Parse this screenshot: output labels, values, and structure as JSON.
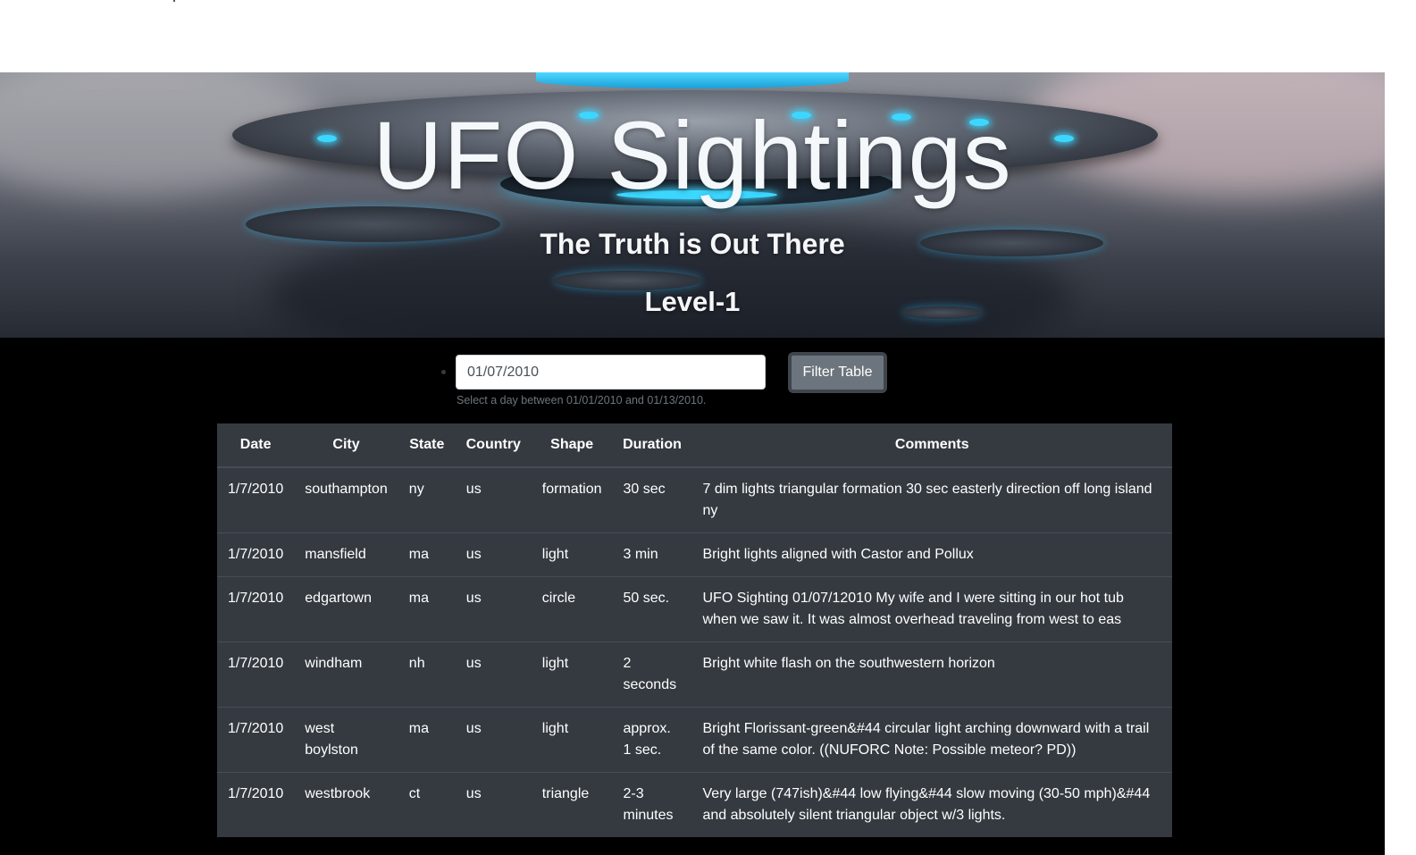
{
  "hero": {
    "title": "UFO Sightings",
    "subtitle": "The Truth is Out There",
    "level": "Level-1"
  },
  "filter": {
    "date_value": "01/07/2010",
    "help_text": "Select a day between 01/01/2010 and 01/13/2010.",
    "button_label": "Filter Table"
  },
  "table": {
    "headers": [
      "Date",
      "City",
      "State",
      "Country",
      "Shape",
      "Duration",
      "Comments"
    ],
    "rows": [
      [
        "1/7/2010",
        "southampton",
        "ny",
        "us",
        "formation",
        "30 sec",
        "7 dim lights triangular formation 30 sec easterly direction off long island ny"
      ],
      [
        "1/7/2010",
        "mansfield",
        "ma",
        "us",
        "light",
        "3 min",
        "Bright lights aligned with Castor and Pollux"
      ],
      [
        "1/7/2010",
        "edgartown",
        "ma",
        "us",
        "circle",
        "50 sec.",
        "UFO Sighting 01/07/12010 My wife and I were sitting in our hot tub when we saw it. It was almost overhead traveling from west to eas"
      ],
      [
        "1/7/2010",
        "windham",
        "nh",
        "us",
        "light",
        "2 seconds",
        "Bright white flash on the southwestern horizon"
      ],
      [
        "1/7/2010",
        "west boylston",
        "ma",
        "us",
        "light",
        "approx. 1 sec.",
        "Bright Florissant-green&#44 circular light arching downward with a trail of the same color. ((NUFORC Note: Possible meteor? PD))"
      ],
      [
        "1/7/2010",
        "westbrook",
        "ct",
        "us",
        "triangle",
        "2-3 minutes",
        "Very large (747ish)&#44 low flying&#44 slow moving (30-50 mph)&#44 and absolutely silent triangular object w/3 lights."
      ]
    ]
  }
}
